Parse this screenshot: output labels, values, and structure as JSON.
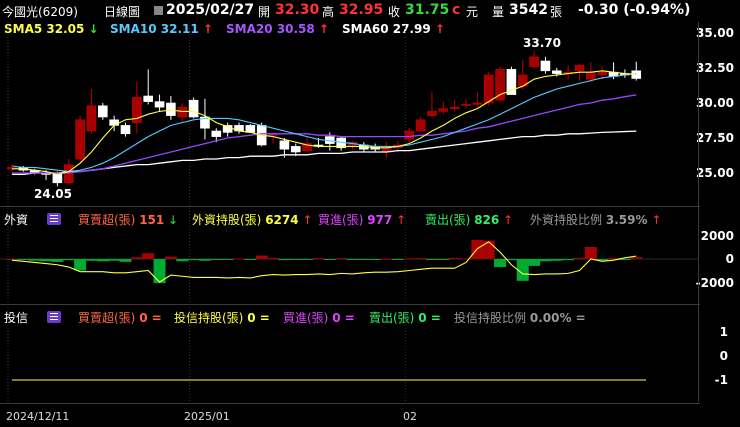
{
  "header": {
    "stock": "今國光(6209)",
    "period": "日線圖",
    "date": "2025/02/27",
    "open_label": "開",
    "open": "32.30",
    "high_label": "高",
    "high": "32.95",
    "close_label": "收",
    "close": "31.75",
    "currency": "元",
    "volume_label": "量",
    "volume": "3542",
    "volume_unit": "張",
    "change": "-0.30 (-0.94%)"
  },
  "ma": {
    "sma5": "SMA5 32.05",
    "sma5_arrow": "↓",
    "sma10": "SMA10 32.11",
    "sma10_arrow": "↑",
    "sma20": "SMA20 30.58",
    "sma20_arrow": "↑",
    "sma60": "SMA60 27.99",
    "sma60_arrow": "↑"
  },
  "price_axis": [
    "35.00",
    "32.50",
    "30.00",
    "27.50",
    "25.00"
  ],
  "annotations": {
    "high_mark": "33.70",
    "low_mark": "24.05"
  },
  "foreign": {
    "title": "外資",
    "net_label": "買賣超(張)",
    "net": "151",
    "net_arrow": "↓",
    "hold_label": "外資持股(張)",
    "hold": "6274",
    "hold_arrow": "↑",
    "buy_label": "買進(張)",
    "buy": "977",
    "buy_arrow": "↑",
    "sell_label": "賣出(張)",
    "sell": "826",
    "sell_arrow": "↑",
    "ratio_label": "外資持股比例",
    "ratio": "3.59%",
    "ratio_arrow": "↑",
    "axis": [
      "2000",
      "0",
      "-2000"
    ]
  },
  "trust": {
    "title": "投信",
    "net_label": "買賣超(張)",
    "net": "0 =",
    "hold_label": "投信持股(張)",
    "hold": "0 =",
    "buy_label": "買進(張)",
    "buy": "0 =",
    "sell_label": "賣出(張)",
    "sell": "0 =",
    "ratio_label": "投信持股比例",
    "ratio": "0.00% =",
    "axis": [
      "1",
      "0",
      "-1"
    ]
  },
  "xaxis": [
    "2024/12/11",
    "2025/01",
    "02"
  ],
  "colors": {
    "up": "#c00000",
    "down": "#ffffff",
    "sma5": "#ffff44",
    "sma10": "#55ccff",
    "sma20": "#9944ff",
    "sma60": "#ffffff",
    "neg_bar": "#00aa33",
    "pos_bar": "#aa0000"
  },
  "candles": [
    {
      "o": 25.3,
      "h": 25.6,
      "l": 25.1,
      "c": 25.4
    },
    {
      "o": 25.4,
      "h": 25.5,
      "l": 25.1,
      "c": 25.2
    },
    {
      "o": 25.2,
      "h": 25.3,
      "l": 24.9,
      "c": 25.0
    },
    {
      "o": 25.0,
      "h": 25.2,
      "l": 24.5,
      "c": 24.9
    },
    {
      "o": 24.9,
      "h": 25.1,
      "l": 24.05,
      "c": 24.3
    },
    {
      "o": 24.3,
      "h": 26.0,
      "l": 24.2,
      "c": 25.6
    },
    {
      "o": 26.0,
      "h": 29.1,
      "l": 25.8,
      "c": 28.8
    },
    {
      "o": 28.0,
      "h": 31.0,
      "l": 27.8,
      "c": 29.8
    },
    {
      "o": 29.8,
      "h": 30.0,
      "l": 28.8,
      "c": 29.0
    },
    {
      "o": 28.8,
      "h": 29.1,
      "l": 28.0,
      "c": 28.4
    },
    {
      "o": 28.4,
      "h": 28.6,
      "l": 27.6,
      "c": 27.8
    },
    {
      "o": 28.6,
      "h": 31.5,
      "l": 27.8,
      "c": 30.4
    },
    {
      "o": 30.5,
      "h": 32.4,
      "l": 29.9,
      "c": 30.1
    },
    {
      "o": 30.1,
      "h": 30.6,
      "l": 29.4,
      "c": 29.7
    },
    {
      "o": 30.0,
      "h": 30.5,
      "l": 28.8,
      "c": 29.1
    },
    {
      "o": 29.0,
      "h": 30.0,
      "l": 28.6,
      "c": 29.7
    },
    {
      "o": 30.2,
      "h": 30.4,
      "l": 28.9,
      "c": 29.0
    },
    {
      "o": 29.0,
      "h": 30.3,
      "l": 27.4,
      "c": 28.2
    },
    {
      "o": 28.0,
      "h": 28.2,
      "l": 27.2,
      "c": 27.6
    },
    {
      "o": 28.4,
      "h": 28.6,
      "l": 27.6,
      "c": 27.9
    },
    {
      "o": 28.4,
      "h": 28.6,
      "l": 27.8,
      "c": 28.0
    },
    {
      "o": 28.4,
      "h": 28.5,
      "l": 27.9,
      "c": 27.9
    },
    {
      "o": 28.4,
      "h": 28.6,
      "l": 26.9,
      "c": 27.0
    },
    {
      "o": 27.7,
      "h": 27.9,
      "l": 27.1,
      "c": 27.8
    },
    {
      "o": 27.3,
      "h": 27.5,
      "l": 26.1,
      "c": 26.7
    },
    {
      "o": 26.9,
      "h": 27.1,
      "l": 26.2,
      "c": 26.5
    },
    {
      "o": 26.6,
      "h": 27.6,
      "l": 26.5,
      "c": 27.1
    },
    {
      "o": 27.0,
      "h": 27.5,
      "l": 26.8,
      "c": 26.9
    },
    {
      "o": 27.6,
      "h": 27.9,
      "l": 26.6,
      "c": 27.1
    },
    {
      "o": 27.5,
      "h": 27.6,
      "l": 26.6,
      "c": 26.8
    },
    {
      "o": 27.0,
      "h": 27.3,
      "l": 26.7,
      "c": 27.2
    },
    {
      "o": 27.0,
      "h": 27.2,
      "l": 26.5,
      "c": 26.7
    },
    {
      "o": 26.9,
      "h": 27.1,
      "l": 26.5,
      "c": 26.7
    },
    {
      "o": 26.5,
      "h": 27.2,
      "l": 26.1,
      "c": 26.9
    },
    {
      "o": 26.8,
      "h": 27.3,
      "l": 26.5,
      "c": 27.0
    },
    {
      "o": 27.4,
      "h": 28.2,
      "l": 27.2,
      "c": 28.0
    },
    {
      "o": 28.0,
      "h": 29.0,
      "l": 27.9,
      "c": 28.8
    },
    {
      "o": 29.1,
      "h": 30.8,
      "l": 29.0,
      "c": 29.4
    },
    {
      "o": 29.4,
      "h": 30.1,
      "l": 29.2,
      "c": 29.6
    },
    {
      "o": 29.6,
      "h": 30.2,
      "l": 29.4,
      "c": 29.7
    },
    {
      "o": 29.9,
      "h": 30.3,
      "l": 29.6,
      "c": 29.9
    },
    {
      "o": 29.9,
      "h": 30.8,
      "l": 29.7,
      "c": 30.0
    },
    {
      "o": 30.0,
      "h": 32.2,
      "l": 29.8,
      "c": 32.0
    },
    {
      "o": 30.2,
      "h": 32.6,
      "l": 30.1,
      "c": 32.4
    },
    {
      "o": 32.4,
      "h": 32.6,
      "l": 30.6,
      "c": 30.6
    },
    {
      "o": 31.2,
      "h": 33.1,
      "l": 31.0,
      "c": 32.0
    },
    {
      "o": 32.6,
      "h": 33.7,
      "l": 32.5,
      "c": 33.3
    },
    {
      "o": 33.0,
      "h": 33.3,
      "l": 32.1,
      "c": 32.3
    },
    {
      "o": 32.3,
      "h": 32.5,
      "l": 31.9,
      "c": 32.1
    },
    {
      "o": 32.1,
      "h": 32.7,
      "l": 31.7,
      "c": 32.2
    },
    {
      "o": 32.3,
      "h": 32.8,
      "l": 31.6,
      "c": 32.7
    },
    {
      "o": 31.7,
      "h": 32.9,
      "l": 31.5,
      "c": 32.2
    },
    {
      "o": 32.0,
      "h": 32.6,
      "l": 31.7,
      "c": 32.2
    },
    {
      "o": 32.2,
      "h": 32.9,
      "l": 31.7,
      "c": 31.9
    },
    {
      "o": 32.1,
      "h": 32.4,
      "l": 31.8,
      "c": 32.0
    },
    {
      "o": 32.3,
      "h": 32.95,
      "l": 31.6,
      "c": 31.75
    }
  ],
  "sma5_series": [
    25.3,
    25.3,
    25.2,
    25.1,
    24.9,
    25.1,
    25.7,
    26.5,
    27.5,
    28.4,
    28.8,
    28.9,
    29.2,
    29.4,
    29.5,
    29.4,
    29.4,
    29.1,
    28.6,
    28.3,
    28.0,
    27.9,
    27.7,
    27.6,
    27.4,
    27.2,
    27.0,
    26.9,
    26.9,
    26.9,
    26.9,
    26.9,
    26.8,
    26.8,
    26.9,
    27.1,
    27.5,
    28.0,
    28.4,
    28.9,
    29.3,
    29.6,
    30.1,
    30.6,
    30.9,
    31.2,
    31.7,
    31.9,
    32.0,
    32.1,
    32.2,
    32.2,
    32.3,
    32.2,
    32.1,
    32.05
  ],
  "sma10_series": [
    25.5,
    25.4,
    25.4,
    25.3,
    25.2,
    25.1,
    25.2,
    25.4,
    25.7,
    26.1,
    26.6,
    27.1,
    27.6,
    28.0,
    28.4,
    28.6,
    28.8,
    28.9,
    28.9,
    28.9,
    28.8,
    28.6,
    28.4,
    28.2,
    28.0,
    27.8,
    27.6,
    27.4,
    27.3,
    27.2,
    27.1,
    27.0,
    26.9,
    26.9,
    26.9,
    27.0,
    27.2,
    27.4,
    27.6,
    27.9,
    28.2,
    28.5,
    28.8,
    29.2,
    29.6,
    30.0,
    30.4,
    30.7,
    31.0,
    31.2,
    31.4,
    31.6,
    31.8,
    31.9,
    32.0,
    32.11
  ],
  "sma20_series": [
    25.0,
    25.0,
    25.0,
    25.0,
    25.0,
    25.0,
    25.1,
    25.2,
    25.3,
    25.5,
    25.7,
    25.9,
    26.1,
    26.3,
    26.5,
    26.7,
    26.9,
    27.1,
    27.3,
    27.5,
    27.6,
    27.7,
    27.8,
    27.8,
    27.8,
    27.8,
    27.8,
    27.7,
    27.7,
    27.6,
    27.6,
    27.6,
    27.6,
    27.6,
    27.6,
    27.6,
    27.7,
    27.7,
    27.8,
    27.9,
    28.0,
    28.2,
    28.3,
    28.5,
    28.7,
    28.9,
    29.1,
    29.3,
    29.5,
    29.7,
    29.9,
    30.0,
    30.2,
    30.3,
    30.45,
    30.58
  ],
  "sma60_series": [
    24.9,
    24.9,
    25.0,
    25.0,
    25.0,
    25.1,
    25.1,
    25.2,
    25.3,
    25.4,
    25.5,
    25.6,
    25.6,
    25.7,
    25.8,
    25.9,
    25.9,
    26.0,
    26.0,
    26.1,
    26.1,
    26.2,
    26.2,
    26.2,
    26.3,
    26.3,
    26.3,
    26.4,
    26.4,
    26.4,
    26.5,
    26.5,
    26.5,
    26.5,
    26.6,
    26.6,
    26.7,
    26.8,
    26.9,
    27.0,
    27.1,
    27.2,
    27.3,
    27.4,
    27.5,
    27.6,
    27.6,
    27.7,
    27.7,
    27.8,
    27.8,
    27.85,
    27.9,
    27.93,
    27.96,
    27.99
  ],
  "foreign_bars": [
    0,
    -50,
    -150,
    -200,
    -250,
    -100,
    -1000,
    -150,
    -200,
    -150,
    -250,
    150,
    500,
    -2100,
    200,
    -200,
    -100,
    -150,
    -80,
    -50,
    50,
    -50,
    300,
    100,
    -100,
    -50,
    -50,
    80,
    -50,
    80,
    -60,
    -40,
    -30,
    20,
    -40,
    30,
    80,
    -40,
    -50,
    100,
    50,
    1650,
    1600,
    -700,
    -100,
    -1900,
    -600,
    -200,
    -150,
    -100,
    100,
    1050,
    -120,
    80,
    -60,
    151
  ],
  "foreign_line": [
    -100,
    -200,
    -300,
    -400,
    -500,
    -700,
    -1100,
    -1100,
    -1100,
    -1200,
    -1200,
    -1100,
    -1000,
    -2000,
    -1400,
    -1500,
    -1600,
    -1600,
    -1600,
    -1650,
    -1600,
    -1650,
    -1450,
    -1350,
    -1400,
    -1350,
    -1350,
    -1300,
    -1350,
    -1250,
    -1300,
    -1200,
    -1150,
    -1150,
    -1100,
    -1000,
    -900,
    -800,
    -800,
    -800,
    -300,
    900,
    1500,
    600,
    -500,
    -1300,
    -1350,
    -1300,
    -1300,
    -1250,
    -1000,
    0,
    -200,
    -100,
    100,
    250
  ]
}
